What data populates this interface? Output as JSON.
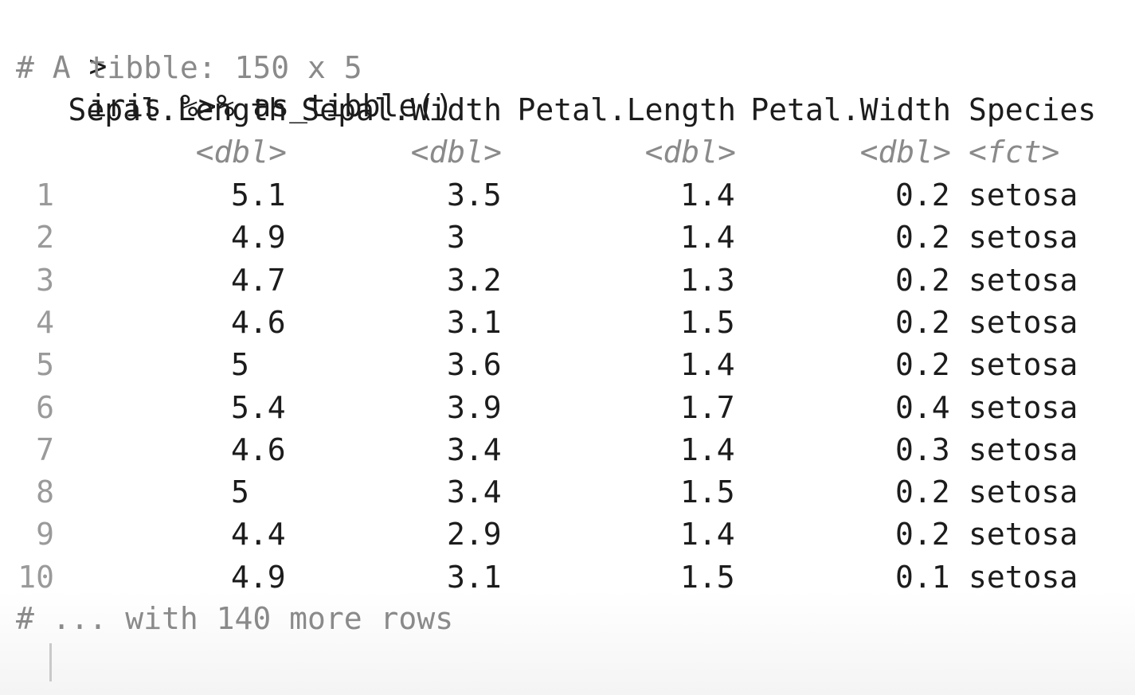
{
  "console": {
    "prompt_symbol": ">",
    "command": "iris %>% as_tibble()",
    "tibble_header": "# A tibble: 150 x 5",
    "footer": "# ... with 140 more rows",
    "columns": [
      {
        "name": "Sepal.Length",
        "type": "<dbl>"
      },
      {
        "name": "Sepal.Width",
        "type": "<dbl>"
      },
      {
        "name": "Petal.Length",
        "type": "<dbl>"
      },
      {
        "name": "Petal.Width",
        "type": "<dbl>"
      },
      {
        "name": "Species",
        "type": "<fct>"
      }
    ],
    "rows": [
      {
        "idx": "1",
        "sl": "5.1",
        "sw": "3.5",
        "pl": "1.4",
        "pw": "0.2",
        "sp": "setosa"
      },
      {
        "idx": "2",
        "sl": "4.9",
        "sw": "3",
        "pl": "1.4",
        "pw": "0.2",
        "sp": "setosa"
      },
      {
        "idx": "3",
        "sl": "4.7",
        "sw": "3.2",
        "pl": "1.3",
        "pw": "0.2",
        "sp": "setosa"
      },
      {
        "idx": "4",
        "sl": "4.6",
        "sw": "3.1",
        "pl": "1.5",
        "pw": "0.2",
        "sp": "setosa"
      },
      {
        "idx": "5",
        "sl": "5",
        "sw": "3.6",
        "pl": "1.4",
        "pw": "0.2",
        "sp": "setosa"
      },
      {
        "idx": "6",
        "sl": "5.4",
        "sw": "3.9",
        "pl": "1.7",
        "pw": "0.4",
        "sp": "setosa"
      },
      {
        "idx": "7",
        "sl": "4.6",
        "sw": "3.4",
        "pl": "1.4",
        "pw": "0.3",
        "sp": "setosa"
      },
      {
        "idx": "8",
        "sl": "5",
        "sw": "3.4",
        "pl": "1.5",
        "pw": "0.2",
        "sp": "setosa"
      },
      {
        "idx": "9",
        "sl": "4.4",
        "sw": "2.9",
        "pl": "1.4",
        "pw": "0.2",
        "sp": "setosa"
      },
      {
        "idx": "10",
        "sl": "4.9",
        "sw": "3.1",
        "pl": "1.5",
        "pw": "0.1",
        "sp": "setosa"
      }
    ]
  }
}
